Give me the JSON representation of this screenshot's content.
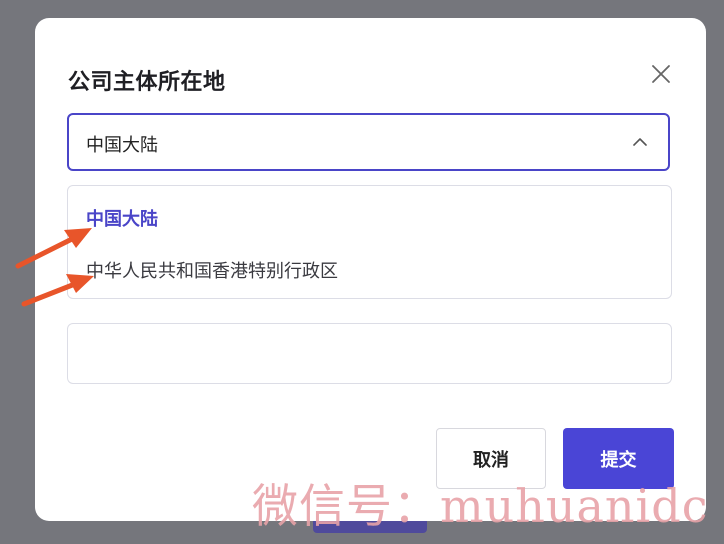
{
  "modal": {
    "title": "公司主体所在地",
    "close_icon": "close-icon"
  },
  "select": {
    "value": "中国大陆",
    "arrow_icon": "chevron-up-icon",
    "options": [
      {
        "label": "中国大陆",
        "selected": true
      },
      {
        "label": "中华人民共和国香港特别行政区",
        "selected": false
      }
    ]
  },
  "text_field": {
    "value": ""
  },
  "buttons": {
    "cancel_label": "取消",
    "submit_label": "提交"
  },
  "annotation": {
    "arrow_color": "#e8552a"
  },
  "watermark": {
    "text": "微信号：muhuanidc"
  },
  "colors": {
    "accent": "#4a45d6",
    "backdrop": "#75767c"
  }
}
